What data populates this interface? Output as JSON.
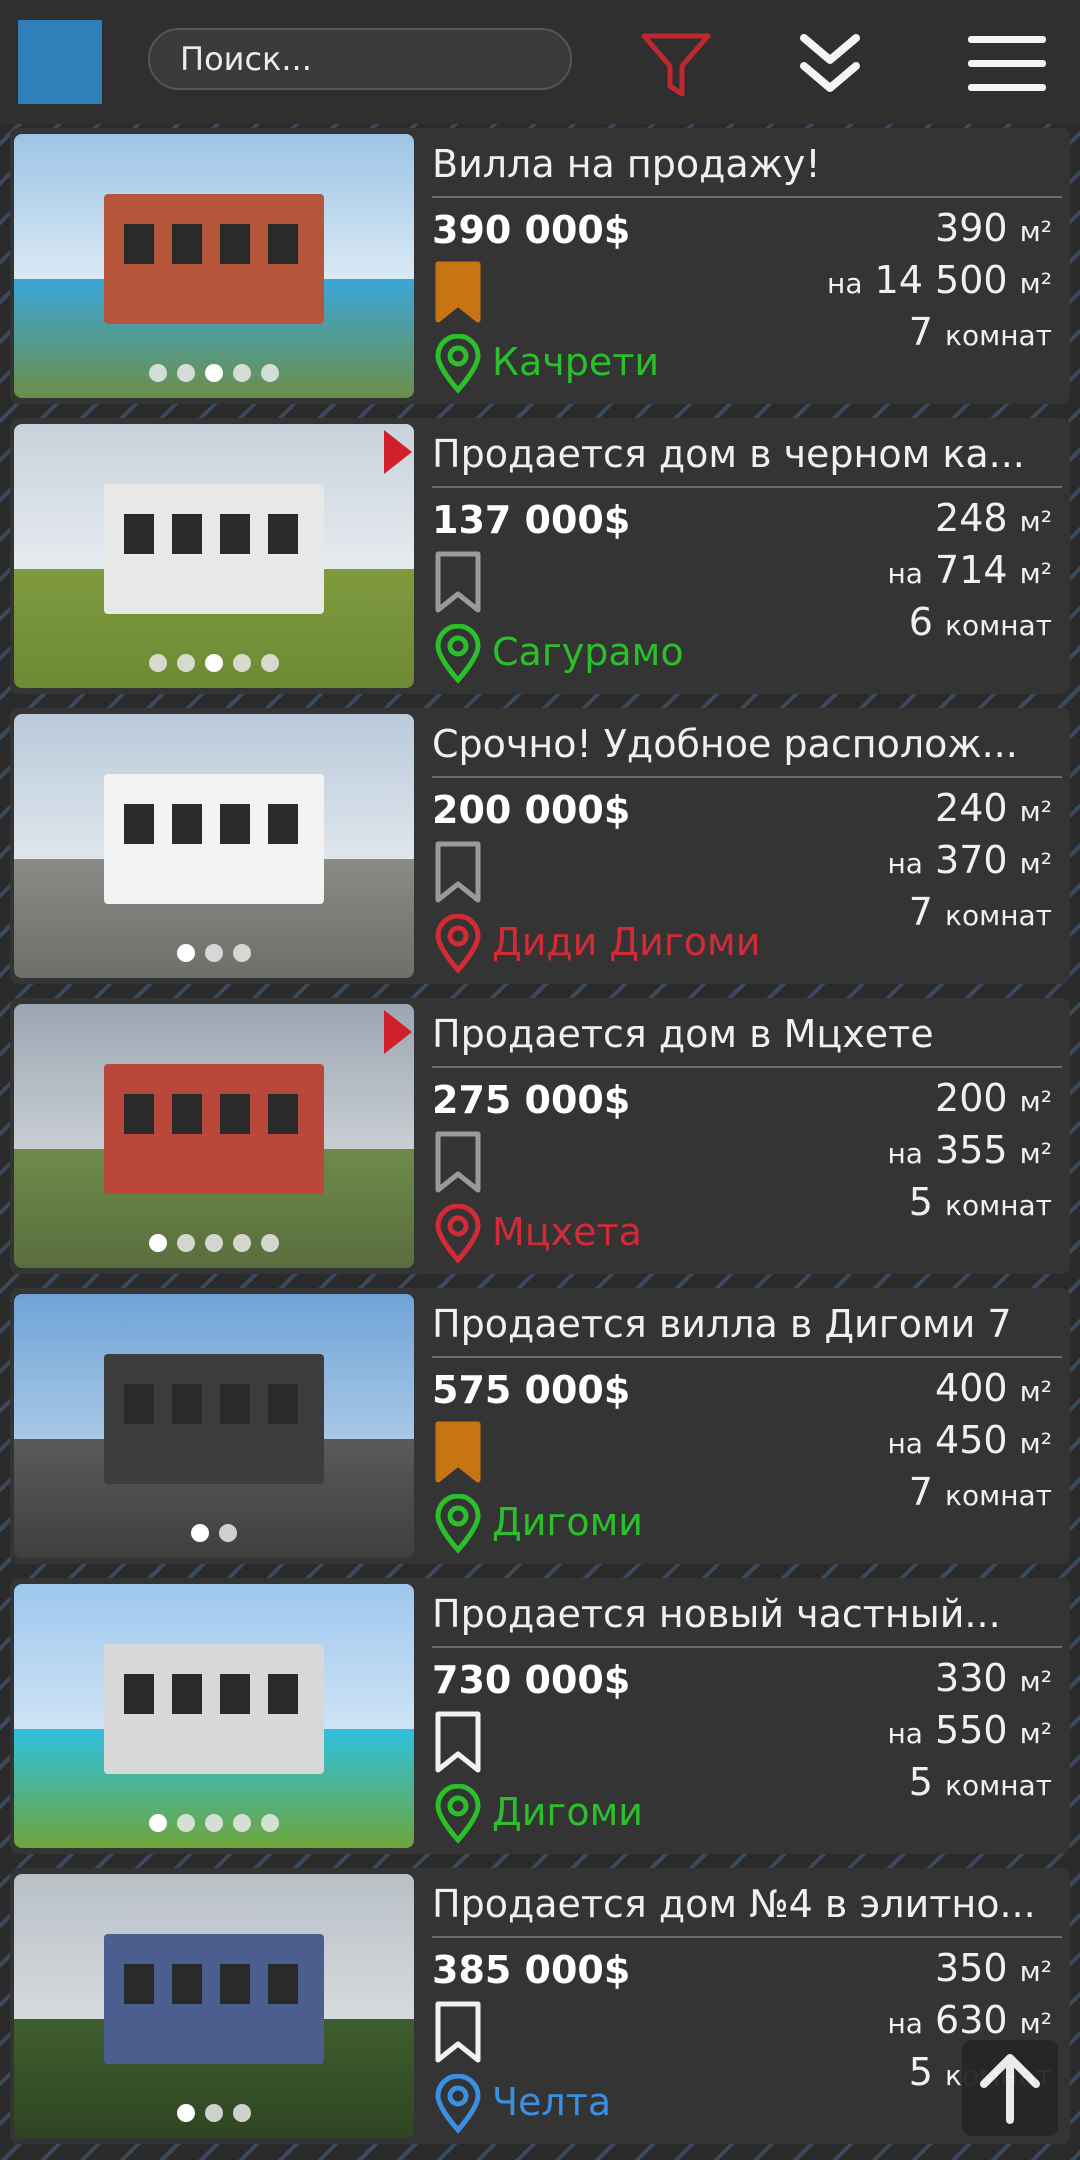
{
  "header": {
    "search_placeholder": "Поиск...",
    "filter_icon": "filter-icon",
    "collapse_icon": "double-chevron-down-icon",
    "menu_icon": "hamburger-menu-icon",
    "accent_color": "#2f80b8",
    "filter_color": "#c0282f"
  },
  "listings": [
    {
      "title": "Вилла на продажу!",
      "price": "390 000$",
      "area": "390",
      "area_unit": "м²",
      "plot_prefix": "на",
      "plot": "14 500",
      "rooms": "7",
      "rooms_label": "комнат",
      "location": "Качрети",
      "location_color": "#2bbf2b",
      "bookmarked": "true",
      "photo_count": 5,
      "active_photo": 3,
      "promoted": "false"
    },
    {
      "title": "Продается дом в черном ка...",
      "price": "137 000$",
      "area": "248",
      "area_unit": "м²",
      "plot_prefix": "на",
      "plot": "714",
      "rooms": "6",
      "rooms_label": "комнат",
      "location": "Сагурамо",
      "location_color": "#2bbf2b",
      "bookmarked": "false",
      "photo_count": 5,
      "active_photo": 3,
      "promoted": "true"
    },
    {
      "title": "Срочно! Удобное располож...",
      "price": "200 000$",
      "area": "240",
      "area_unit": "м²",
      "plot_prefix": "на",
      "plot": "370",
      "rooms": "7",
      "rooms_label": "комнат",
      "location": "Диди Дигоми",
      "location_color": "#d22b36",
      "bookmarked": "false",
      "photo_count": 3,
      "active_photo": 1,
      "promoted": "false"
    },
    {
      "title": "Продается дом в Мцхете",
      "price": "275 000$",
      "area": "200",
      "area_unit": "м²",
      "plot_prefix": "на",
      "plot": "355",
      "rooms": "5",
      "rooms_label": "комнат",
      "location": "Мцхета",
      "location_color": "#d22b36",
      "bookmarked": "false",
      "photo_count": 5,
      "active_photo": 1,
      "promoted": "true"
    },
    {
      "title": "Продается вилла в Дигоми 7",
      "price": "575 000$",
      "area": "400",
      "area_unit": "м²",
      "plot_prefix": "на",
      "plot": "450",
      "rooms": "7",
      "rooms_label": "комнат",
      "location": "Дигоми",
      "location_color": "#2bbf2b",
      "bookmarked": "true",
      "photo_count": 2,
      "active_photo": 1,
      "promoted": "false"
    },
    {
      "title": "Продается новый частный...",
      "price": "730 000$",
      "area": "330",
      "area_unit": "м²",
      "plot_prefix": "на",
      "plot": "550",
      "rooms": "5",
      "rooms_label": "комнат",
      "location": "Дигоми",
      "location_color": "#2bbf2b",
      "bookmarked": "false-white",
      "photo_count": 5,
      "active_photo": 1,
      "promoted": "false"
    },
    {
      "title": "Продается дом №4 в элитно...",
      "price": "385 000$",
      "area": "350",
      "area_unit": "м²",
      "plot_prefix": "на",
      "plot": "630",
      "rooms": "5",
      "rooms_label": "комнат",
      "location": "Челта",
      "location_color": "#3a8fe0",
      "bookmarked": "false-white",
      "photo_count": 3,
      "active_photo": 1,
      "promoted": "false"
    }
  ],
  "scroll_top_icon": "arrow-up-icon"
}
